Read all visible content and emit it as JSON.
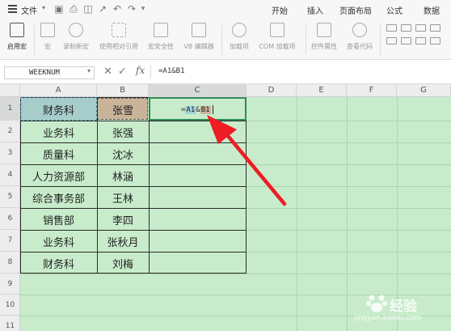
{
  "menubar": {
    "file_label": "文件",
    "tabs": [
      "开始",
      "插入",
      "页面布局",
      "公式",
      "数据"
    ]
  },
  "ribbon": {
    "items": [
      "启用宏",
      "宏",
      "录制新宏",
      "使用相对引用",
      "宏安全性",
      "VB 编辑器",
      "加载项",
      "COM 加载项",
      "控件属性",
      "查看代码"
    ]
  },
  "formula_bar": {
    "name_box": "WEEKNUM",
    "fx_label": "fx",
    "content": "=A1&B1"
  },
  "sheet": {
    "columns": [
      "A",
      "B",
      "C",
      "D",
      "E",
      "F",
      "G"
    ],
    "rows": [
      "1",
      "2",
      "3",
      "4",
      "5",
      "6",
      "7",
      "8",
      "9",
      "10",
      "11"
    ],
    "departments": [
      "财务科",
      "业务科",
      "质量科",
      "人力资源部",
      "综合事务部",
      "销售部",
      "业务科",
      "财务科"
    ],
    "names": [
      "张雪",
      "张强",
      "沈冰",
      "林涵",
      "王林",
      "李四",
      "张秋月",
      "刘梅"
    ],
    "editing_cell": {
      "prefix": "=",
      "ref1": "A1",
      "op": "&",
      "ref2": "B1"
    }
  },
  "watermark": {
    "text": "经验",
    "url": "jingyan.baidu.com"
  },
  "colors": {
    "sheet_bg": "#c8eccb",
    "a1_fill": "#a7cdcb",
    "b1_fill": "#c9b49a",
    "arrow": "#ee1c25"
  }
}
